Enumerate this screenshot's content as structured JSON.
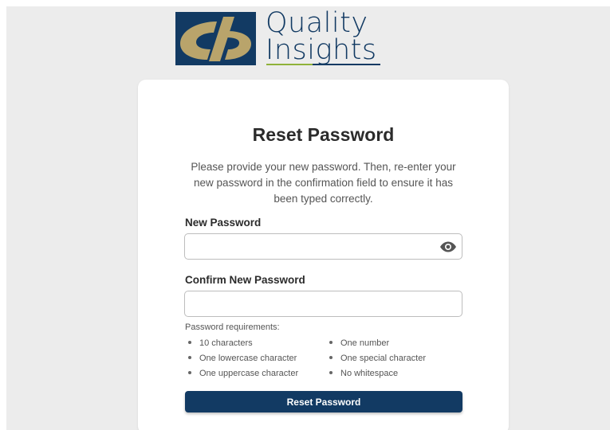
{
  "logo": {
    "line1": "Quality",
    "line2": "Insights",
    "colors": {
      "navy": "#123a63",
      "gold": "#b9a46b",
      "green": "#8fb23a"
    }
  },
  "card": {
    "title": "Reset Password",
    "description": "Please provide your new password. Then, re-enter your new password in the confirmation field to ensure it has been typed correctly."
  },
  "new_password": {
    "label": "New Password",
    "value": "",
    "toggle_icon": "eye-icon"
  },
  "confirm_password": {
    "label": "Confirm New Password",
    "value": ""
  },
  "requirements": {
    "title": "Password requirements:",
    "items": [
      "10 characters",
      "One number",
      "One lowercase character",
      "One special character",
      "One uppercase character",
      "No whitespace"
    ]
  },
  "submit": {
    "label": "Reset Password"
  }
}
